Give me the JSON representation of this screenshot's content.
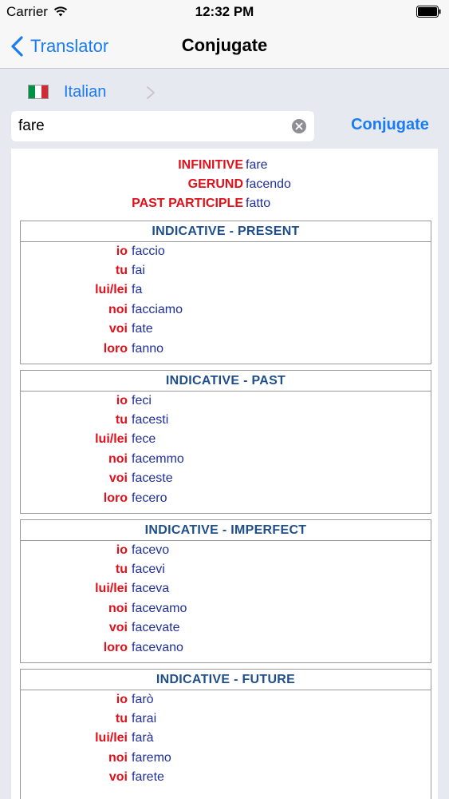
{
  "status_bar": {
    "carrier": "Carrier",
    "time": "12:32 PM"
  },
  "nav": {
    "back_label": "Translator",
    "title": "Conjugate"
  },
  "language": {
    "name": "Italian",
    "flag_colors": [
      "#009246",
      "#ffffff",
      "#ce2b37"
    ]
  },
  "search": {
    "value": "fare"
  },
  "conjugate_button": "Conjugate",
  "forms": [
    {
      "label": "INFINITIVE",
      "value": "fare"
    },
    {
      "label": "GERUND",
      "value": "facendo"
    },
    {
      "label": "PAST PARTICIPLE",
      "value": "fatto"
    }
  ],
  "sections": [
    {
      "title": "INDICATIVE - PRESENT",
      "rows": [
        {
          "pronoun": "io",
          "verb": "faccio"
        },
        {
          "pronoun": "tu",
          "verb": "fai"
        },
        {
          "pronoun": "lui/lei",
          "verb": "fa"
        },
        {
          "pronoun": "noi",
          "verb": "facciamo"
        },
        {
          "pronoun": "voi",
          "verb": "fate"
        },
        {
          "pronoun": "loro",
          "verb": "fanno"
        }
      ]
    },
    {
      "title": "INDICATIVE - PAST",
      "rows": [
        {
          "pronoun": "io",
          "verb": "feci"
        },
        {
          "pronoun": "tu",
          "verb": "facesti"
        },
        {
          "pronoun": "lui/lei",
          "verb": "fece"
        },
        {
          "pronoun": "noi",
          "verb": "facemmo"
        },
        {
          "pronoun": "voi",
          "verb": "faceste"
        },
        {
          "pronoun": "loro",
          "verb": "fecero"
        }
      ]
    },
    {
      "title": "INDICATIVE - IMPERFECT",
      "rows": [
        {
          "pronoun": "io",
          "verb": "facevo"
        },
        {
          "pronoun": "tu",
          "verb": "facevi"
        },
        {
          "pronoun": "lui/lei",
          "verb": "faceva"
        },
        {
          "pronoun": "noi",
          "verb": "facevamo"
        },
        {
          "pronoun": "voi",
          "verb": "facevate"
        },
        {
          "pronoun": "loro",
          "verb": "facevano"
        }
      ]
    },
    {
      "title": "INDICATIVE - FUTURE",
      "rows": [
        {
          "pronoun": "io",
          "verb": "farò"
        },
        {
          "pronoun": "tu",
          "verb": "farai"
        },
        {
          "pronoun": "lui/lei",
          "verb": "farà"
        },
        {
          "pronoun": "noi",
          "verb": "faremo"
        },
        {
          "pronoun": "voi",
          "verb": "farete"
        }
      ]
    }
  ],
  "colors": {
    "accent": "#1a7cf5",
    "label_red": "#e2101a",
    "value_blue": "#1f2f9e",
    "header_blue": "#1f4e8c"
  }
}
